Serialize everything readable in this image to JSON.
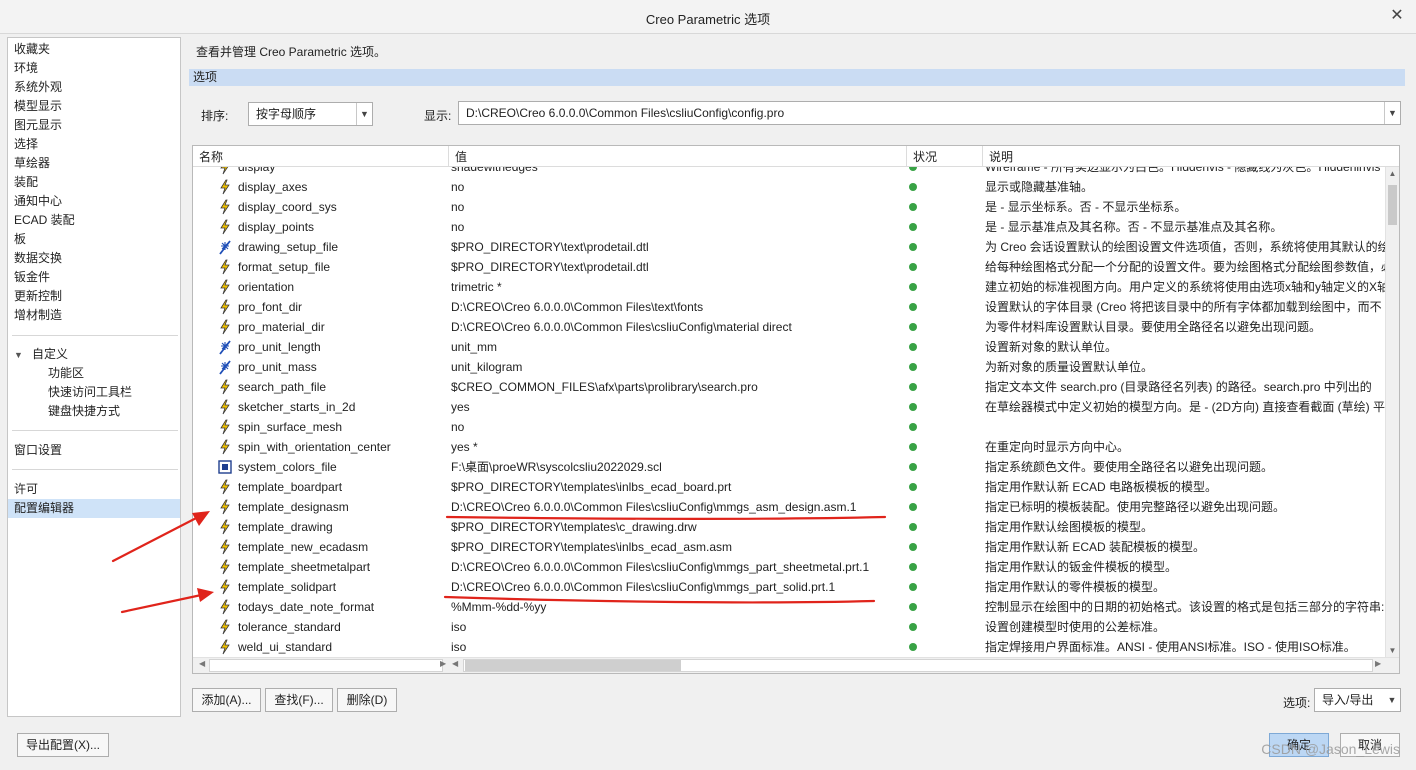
{
  "window": {
    "title": "Creo Parametric 选项"
  },
  "nav": {
    "items": [
      "收藏夹",
      "环境",
      "系统外观",
      "模型显示",
      "图元显示",
      "选择",
      "草绘器",
      "装配",
      "通知中心",
      "ECAD 装配",
      "板",
      "数据交换",
      "钣金件",
      "更新控制",
      "增材制造"
    ],
    "custom": {
      "label": "自定义",
      "children": [
        "功能区",
        "快速访问工具栏",
        "键盘快捷方式"
      ]
    },
    "window_settings": "窗口设置",
    "license": "许可",
    "config_editor": "配置编辑器"
  },
  "header": {
    "description": "查看并管理 Creo Parametric 选项。",
    "section": "选项"
  },
  "toolbar": {
    "sort_label": "排序:",
    "sort_value": "按字母顺序",
    "show_label": "显示:",
    "show_value": "D:\\CREO\\Creo 6.0.0.0\\Common Files\\csliuConfig\\config.pro"
  },
  "table": {
    "columns": [
      "名称",
      "值",
      "状况",
      "说明"
    ],
    "rows": [
      {
        "icon": "lightning",
        "name": "display",
        "value": "shadewithedges",
        "desc": "Wireframe - 所有实边显示为白色。Hiddenvis - 隐藏线为灰色。Hiddeninvis"
      },
      {
        "icon": "lightning",
        "name": "display_axes",
        "value": "no",
        "desc": "显示或隐藏基准轴。"
      },
      {
        "icon": "lightning",
        "name": "display_coord_sys",
        "value": "no",
        "desc": "是 - 显示坐标系。否 - 不显示坐标系。"
      },
      {
        "icon": "lightning",
        "name": "display_points",
        "value": "no",
        "desc": "是 - 显示基准点及其名称。否 - 不显示基准点及其名称。"
      },
      {
        "icon": "star",
        "name": "drawing_setup_file",
        "value": "$PRO_DIRECTORY\\text\\prodetail.dtl",
        "desc": "为 Creo 会话设置默认的绘图设置文件选项值，否则，系统将使用其默认的绘"
      },
      {
        "icon": "lightning",
        "name": "format_setup_file",
        "value": "$PRO_DIRECTORY\\text\\prodetail.dtl",
        "desc": "给每种绘图格式分配一个分配的设置文件。要为绘图格式分配绘图参数值，必"
      },
      {
        "icon": "lightning",
        "name": "orientation",
        "value": "trimetric *",
        "desc": "建立初始的标准视图方向。用户定义的系统将使用由选项x轴和y轴定义的X轴"
      },
      {
        "icon": "lightning",
        "name": "pro_font_dir",
        "value": "D:\\CREO\\Creo 6.0.0.0\\Common Files\\text\\fonts",
        "desc": "设置默认的字体目录 (Creo 将把该目录中的所有字体都加载到绘图中，而不"
      },
      {
        "icon": "lightning",
        "name": "pro_material_dir",
        "value": "D:\\CREO\\Creo 6.0.0.0\\Common Files\\csliuConfig\\material direct",
        "desc": "为零件材料库设置默认目录。要使用全路径名以避免出现问题。"
      },
      {
        "icon": "star",
        "name": "pro_unit_length",
        "value": "unit_mm",
        "desc": "设置新对象的默认单位。"
      },
      {
        "icon": "star",
        "name": "pro_unit_mass",
        "value": "unit_kilogram",
        "desc": "为新对象的质量设置默认单位。"
      },
      {
        "icon": "lightning",
        "name": "search_path_file",
        "value": "$CREO_COMMON_FILES\\afx\\parts\\prolibrary\\search.pro",
        "desc": "指定文本文件 search.pro (目录路径名列表) 的路径。search.pro 中列出的"
      },
      {
        "icon": "lightning",
        "name": "sketcher_starts_in_2d",
        "value": "yes",
        "desc": "在草绘器模式中定义初始的模型方向。是 - (2D方向) 直接查看截面 (草绘) 平"
      },
      {
        "icon": "lightning",
        "name": "spin_surface_mesh",
        "value": "no",
        "desc": ""
      },
      {
        "icon": "lightning",
        "name": "spin_with_orientation_center",
        "value": "yes *",
        "desc": "在重定向时显示方向中心。"
      },
      {
        "icon": "screen",
        "name": "system_colors_file",
        "value": "F:\\桌面\\proeWR\\syscolcsliu2022029.scl",
        "desc": "指定系统颜色文件。要使用全路径名以避免出现问题。"
      },
      {
        "icon": "lightning",
        "name": "template_boardpart",
        "value": "$PRO_DIRECTORY\\templates\\inlbs_ecad_board.prt",
        "desc": "指定用作默认新 ECAD 电路板模板的模型。"
      },
      {
        "icon": "lightning",
        "name": "template_designasm",
        "value": "D:\\CREO\\Creo 6.0.0.0\\Common Files\\csliuConfig\\mmgs_asm_design.asm.1",
        "desc": "指定已标明的模板装配。使用完整路径以避免出现问题。"
      },
      {
        "icon": "lightning",
        "name": "template_drawing",
        "value": "$PRO_DIRECTORY\\templates\\c_drawing.drw",
        "desc": "指定用作默认绘图模板的模型。"
      },
      {
        "icon": "lightning",
        "name": "template_new_ecadasm",
        "value": "$PRO_DIRECTORY\\templates\\inlbs_ecad_asm.asm",
        "desc": "指定用作默认新 ECAD 装配模板的模型。"
      },
      {
        "icon": "lightning",
        "name": "template_sheetmetalpart",
        "value": "D:\\CREO\\Creo 6.0.0.0\\Common Files\\csliuConfig\\mmgs_part_sheetmetal.prt.1",
        "desc": "指定用作默认的钣金件模板的模型。"
      },
      {
        "icon": "lightning",
        "name": "template_solidpart",
        "value": "D:\\CREO\\Creo 6.0.0.0\\Common Files\\csliuConfig\\mmgs_part_solid.prt.1",
        "desc": "指定用作默认的零件模板的模型。"
      },
      {
        "icon": "lightning",
        "name": "todays_date_note_format",
        "value": "%Mmm-%dd-%yy",
        "desc": "控制显示在绘图中的日期的初始格式。该设置的格式是包括三部分的字符串:"
      },
      {
        "icon": "lightning",
        "name": "tolerance_standard",
        "value": "iso",
        "desc": "设置创建模型时使用的公差标准。"
      },
      {
        "icon": "lightning",
        "name": "weld_ui_standard",
        "value": "iso",
        "desc": "指定焊接用户界面标准。ANSI - 使用ANSI标准。ISO - 使用ISO标准。"
      }
    ]
  },
  "buttons": {
    "add": "添加(A)...",
    "find": "查找(F)...",
    "delete": "删除(D)",
    "options_label": "选项:",
    "import_export": "导入/导出",
    "export_config": "导出配置(X)...",
    "ok": "确定",
    "cancel": "取消"
  },
  "watermark": "CSDN @Jason_Lewis",
  "colors": {
    "status_ok": "#38a245",
    "annotation": "#e0241b",
    "selection": "#cfe3f8",
    "section_bar": "#cadcf3"
  }
}
